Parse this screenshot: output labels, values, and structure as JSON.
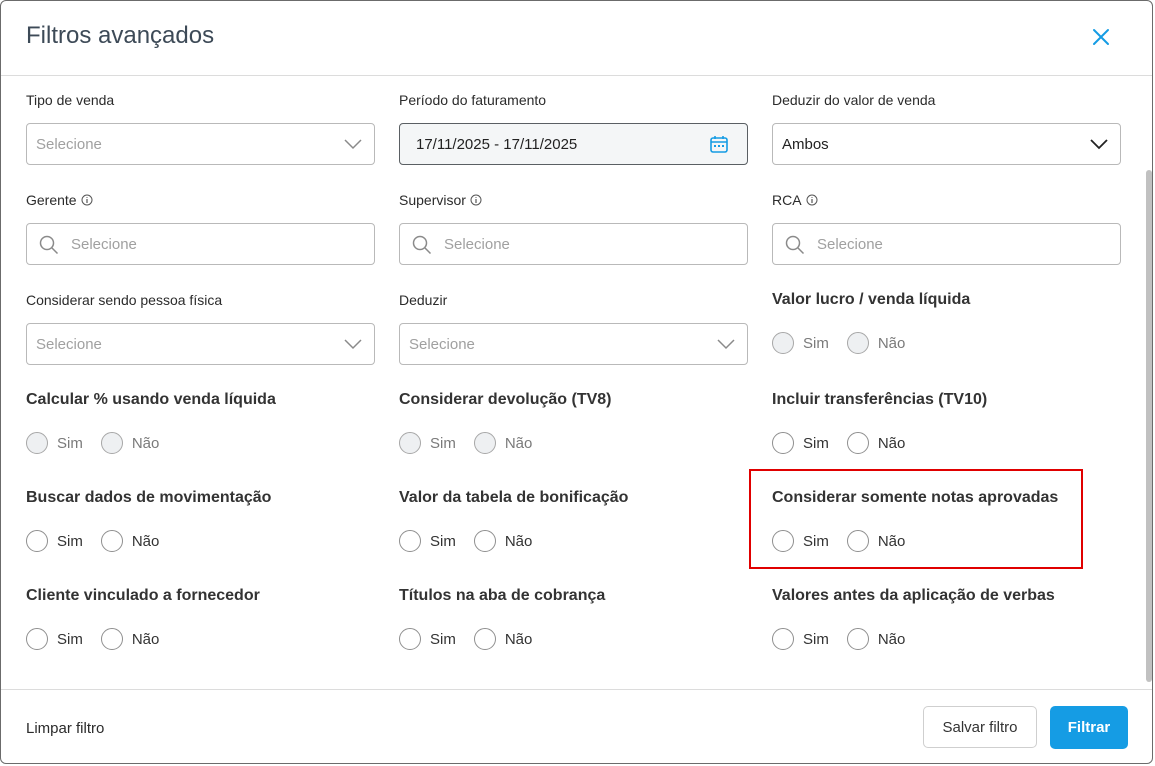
{
  "modal": {
    "title": "Filtros avançados"
  },
  "colors": {
    "accent": "#159ce4",
    "highlight": "#e00000"
  },
  "row1": {
    "tipo_venda": {
      "label": "Tipo de venda",
      "value": "Selecione"
    },
    "periodo": {
      "label": "Período do faturamento",
      "value": "17/11/2025 - 17/11/2025"
    },
    "deduzir_valor": {
      "label": "Deduzir do valor de venda",
      "value": "Ambos"
    }
  },
  "row2": {
    "gerente": {
      "label": "Gerente",
      "placeholder": "Selecione"
    },
    "supervisor": {
      "label": "Supervisor",
      "placeholder": "Selecione"
    },
    "rca": {
      "label": "RCA",
      "placeholder": "Selecione"
    }
  },
  "row3": {
    "pessoa_fisica": {
      "label": "Considerar sendo pessoa física",
      "value": "Selecione"
    },
    "deduzir": {
      "label": "Deduzir",
      "value": "Selecione"
    },
    "valor_lucro": {
      "label": "Valor lucro / venda líquida"
    }
  },
  "radio_options": {
    "yes": "Sim",
    "no": "Não"
  },
  "row4": {
    "calcular_pct": {
      "label": "Calcular % usando venda líquida"
    },
    "devolucao": {
      "label": "Considerar devolução (TV8)"
    },
    "transferencias": {
      "label": "Incluir transferências (TV10)"
    }
  },
  "row5": {
    "movimentacao": {
      "label": "Buscar dados de movimentação"
    },
    "bonificacao": {
      "label": "Valor da tabela de bonificação"
    },
    "notas_aprovadas": {
      "label": "Considerar somente notas aprovadas"
    }
  },
  "row6": {
    "cliente_fornecedor": {
      "label": "Cliente vinculado a fornecedor"
    },
    "titulos_cobranca": {
      "label": "Títulos na aba de cobrança"
    },
    "valores_verbas": {
      "label": "Valores antes da aplicação de verbas"
    }
  },
  "footer": {
    "clear_label": "Limpar filtro",
    "save_label": "Salvar filtro",
    "filter_label": "Filtrar"
  }
}
